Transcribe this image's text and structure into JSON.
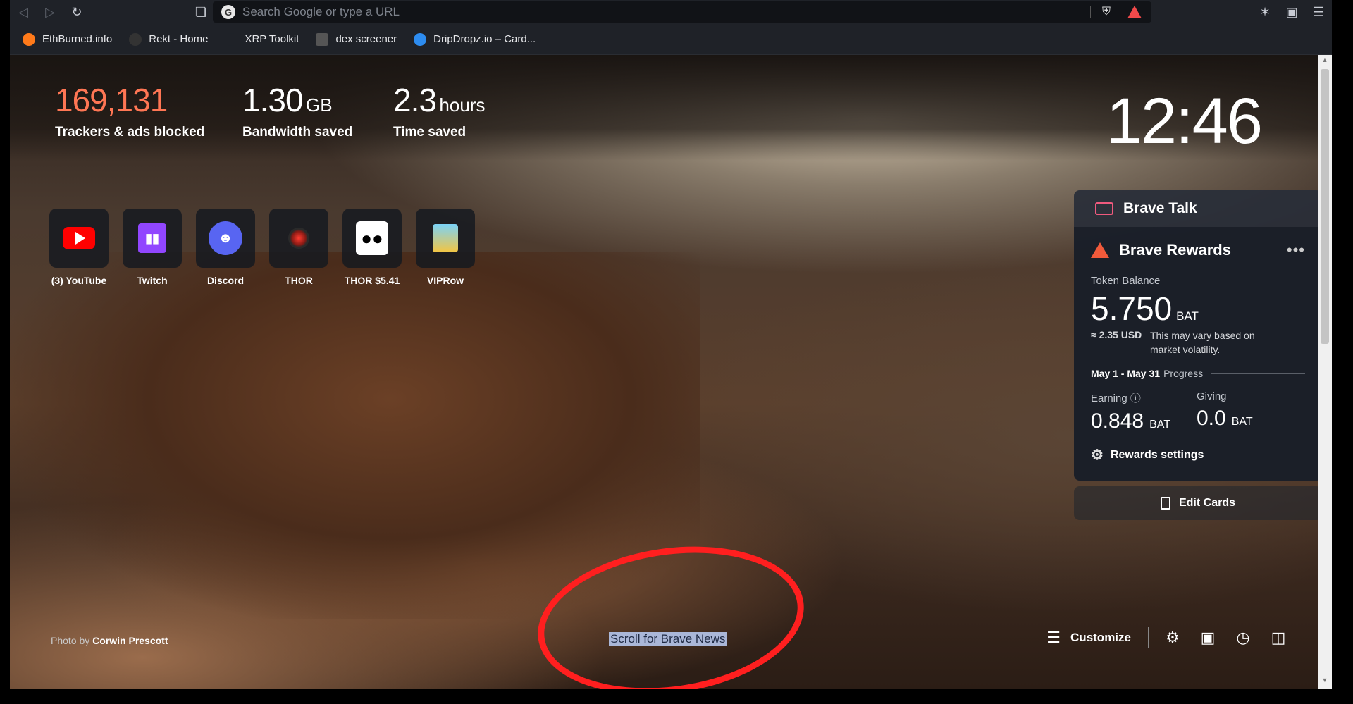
{
  "toolbar": {
    "back_icon": "back-arrow-icon",
    "forward_icon": "forward-arrow-icon",
    "reload_icon": "reload-icon",
    "bookmark_icon": "bookmark-icon",
    "url_placeholder": "Search Google or type a URL",
    "right_icons": [
      "extensions-icon",
      "wallet-icon",
      "menu-icon"
    ]
  },
  "bookmarks": [
    {
      "label": "EthBurned.info",
      "color": "#ff7a1a"
    },
    {
      "label": "Rekt - Home",
      "color": "#222222"
    },
    {
      "label": "XRP Toolkit",
      "color": "#1f2228"
    },
    {
      "label": "dex screener",
      "color": "#444444"
    },
    {
      "label": "DripDropz.io – Card...",
      "color": "#2d8cf0"
    }
  ],
  "stats": {
    "trackers": {
      "value": "169,131",
      "label": "Trackers & ads blocked"
    },
    "bandwidth": {
      "value": "1.30",
      "unit": "GB",
      "label": "Bandwidth saved"
    },
    "time": {
      "value": "2.3",
      "unit": "hours",
      "label": "Time saved"
    }
  },
  "clock": "12:46",
  "top_sites": [
    {
      "name": "(3) YouTube",
      "icon": "youtube-icon"
    },
    {
      "name": "Twitch",
      "icon": "twitch-icon"
    },
    {
      "name": "Discord",
      "icon": "discord-icon"
    },
    {
      "name": "THOR",
      "icon": "thor-icon"
    },
    {
      "name": "THOR $5.41",
      "icon": "owl-icon"
    },
    {
      "name": "VIPRow",
      "icon": "viprow-icon"
    }
  ],
  "brave_talk": {
    "title": "Brave Talk"
  },
  "brave_rewards": {
    "title": "Brave Rewards",
    "more": "•••",
    "token_label": "Token Balance",
    "balance": "5.750",
    "balance_unit": "BAT",
    "usd": "≈ 2.35 USD",
    "note": "This may vary based on market volatility.",
    "period": "May 1 - May 31",
    "progress_label": "Progress",
    "earning_label": "Earning",
    "earning_value": "0.848",
    "earning_unit": "BAT",
    "giving_label": "Giving",
    "giving_value": "0.0",
    "giving_unit": "BAT",
    "settings_label": "Rewards settings"
  },
  "edit_cards": "Edit Cards",
  "photo_credit": {
    "prefix": "Photo by",
    "author": "Corwin Prescott"
  },
  "news_label": "Scroll for Brave News",
  "customize_label": "Customize",
  "accent_color": "#ff7654"
}
